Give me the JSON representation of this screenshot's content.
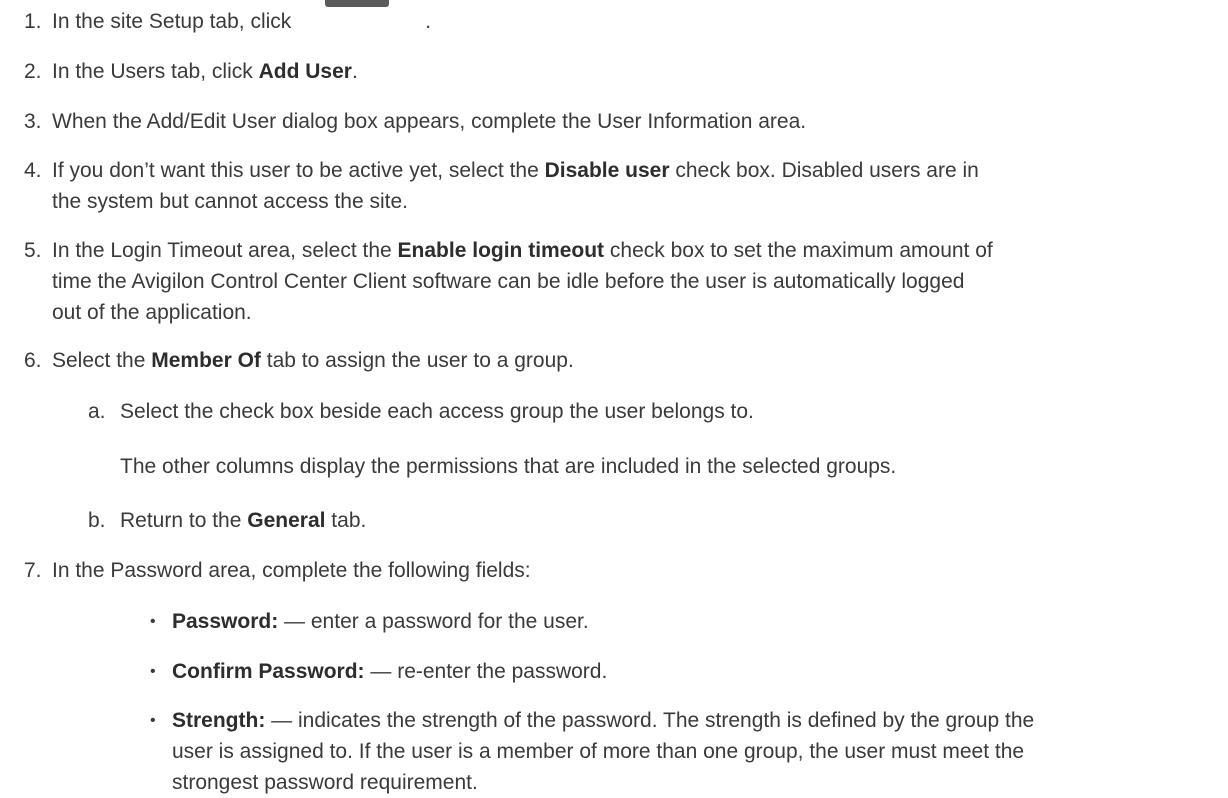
{
  "steps": [
    {
      "num": "1.",
      "pre": "In the site Setup tab, click",
      "post": "."
    },
    {
      "num": "2.",
      "pre": "In the Users tab, click ",
      "bold": "Add User",
      "post": "."
    },
    {
      "num": "3.",
      "text": "When the Add/Edit User dialog box appears, complete the User Information area."
    },
    {
      "num": "4.",
      "pre": "If you don’t want this user to be active yet, select the ",
      "bold": "Disable user",
      "post": " check box. Disabled users are in",
      "line2": "the system but cannot access the site."
    },
    {
      "num": "5.",
      "pre": "In the Login Timeout area, select the ",
      "bold": "Enable login timeout",
      "post": " check box to set the maximum amount of",
      "line2": "time the Avigilon Control Center Client software can be idle before the user is automatically logged",
      "line3": "out of the application."
    },
    {
      "num": "6.",
      "pre": "Select the ",
      "bold": "Member Of",
      "post": " tab to assign the user to a group."
    }
  ],
  "substeps": [
    {
      "num": "a.",
      "text": "Select the check box beside each access group the user belongs to."
    },
    {
      "note": "The other columns display the permissions that are included in the selected groups."
    },
    {
      "num": "b.",
      "pre": "Return to the ",
      "bold": "General",
      "post": " tab."
    }
  ],
  "step7": {
    "num": "7.",
    "text": "In the Password area, complete the following fields:"
  },
  "bullets": [
    {
      "mark": "•",
      "bold": "Password:",
      "post": " — enter a password for the user."
    },
    {
      "mark": "•",
      "bold": "Confirm Password:",
      "post": " — re-enter the password."
    },
    {
      "mark": "•",
      "bold": "Strength:",
      "post": " — indicates the strength of the password. The strength is defined by the group the",
      "line2": "user is assigned to. If the user is a member of more than one group, the user must meet the",
      "line3": "strongest password requirement."
    }
  ]
}
